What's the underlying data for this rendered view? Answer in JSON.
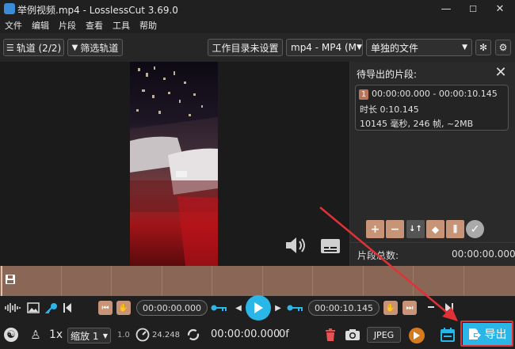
{
  "window": {
    "title": "举例视频.mp4 - LosslessCut 3.69.0",
    "min_glyph": "—",
    "max_glyph": "☐",
    "close_glyph": "✕"
  },
  "menu": [
    "文件",
    "编辑",
    "片段",
    "查看",
    "工具",
    "帮助"
  ],
  "toolbar": {
    "tracks_label": "轨道 (2/2)",
    "filter_tracks_label": "筛选轨道",
    "workdir_label": "工作目录未设置",
    "format_label": "mp4 - MP4 (M",
    "output_mode_label": "单独的文件"
  },
  "segments_panel": {
    "header": "待导出的片段:",
    "close_glyph": "✕",
    "segments": [
      {
        "index": "1",
        "range": "00:00:00.000 - 00:00:10.145",
        "duration": "时长 0:10.145",
        "details": "10145 毫秒, 246 帧, ~2MB"
      }
    ],
    "total_label": "片段总数:",
    "total_value": "00:00:00.000"
  },
  "controls": {
    "start_time": "00:00:00.000",
    "end_time": "00:00:10.145",
    "speed": "1x",
    "zoom_label": "缩放 1",
    "zoom_value": "1.0",
    "fps": "24.248",
    "current_time": "00:00:00.000",
    "frame_offset": "0f",
    "capture_format": "JPEG",
    "export_label": "导出"
  },
  "colors": {
    "accent": "#2ab7e8",
    "segment": "#c79477",
    "timeline": "#8a6657",
    "highlight": "#e03236"
  },
  "icons": [
    "save-icon",
    "waveform-icon",
    "image-icon",
    "key-icon",
    "play-icon",
    "speaker-icon",
    "subtitle-icon",
    "trash-icon",
    "camera-icon",
    "calendar-icon",
    "export-icon",
    "gear-icon"
  ]
}
